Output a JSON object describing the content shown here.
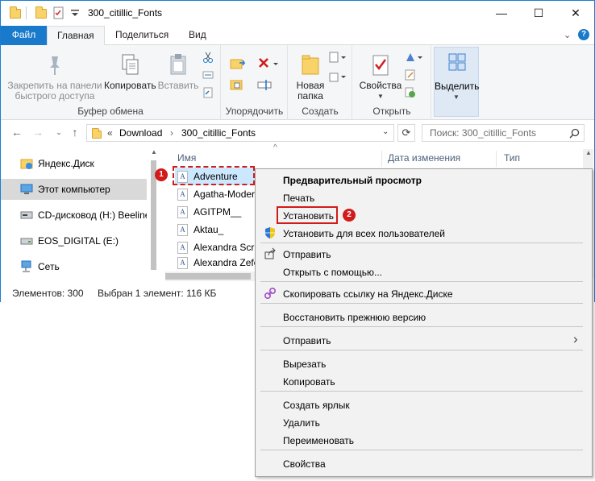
{
  "window": {
    "title": "300_citillic_Fonts",
    "controls": {
      "minimize": "—",
      "maximize": "☐",
      "close": "✕"
    }
  },
  "ribbon_tabs": [
    {
      "label": "Файл"
    },
    {
      "label": "Главная"
    },
    {
      "label": "Поделиться"
    },
    {
      "label": "Вид"
    }
  ],
  "ribbon": {
    "clipboard": {
      "pin_label_1": "Закрепить на панели",
      "pin_label_2": "быстрого доступа",
      "copy_label": "Копировать",
      "paste_label": "Вставить",
      "group_label": "Буфер обмена"
    },
    "organize": {
      "group_label": "Упорядочить"
    },
    "new": {
      "new_folder_label_1": "Новая",
      "new_folder_label_2": "папка",
      "group_label": "Создать"
    },
    "open": {
      "properties_label": "Свойства",
      "group_label": "Открыть"
    },
    "select": {
      "select_label": "Выделить"
    }
  },
  "address": {
    "prefix": "«",
    "crumbs": [
      "Download",
      "300_citillic_Fonts"
    ],
    "search_placeholder": "Поиск: 300_citillic_Fonts"
  },
  "nav_pane": {
    "items": [
      {
        "label": "Яндекс.Диск",
        "icon": "yandex-disk-icon"
      },
      {
        "label": "Этот компьютер",
        "icon": "computer-icon"
      },
      {
        "label": "CD-дисковод (H:) Beeline",
        "icon": "cd-drive-icon"
      },
      {
        "label": "EOS_DIGITAL (E:)",
        "icon": "drive-icon"
      },
      {
        "label": "Сеть",
        "icon": "network-icon"
      }
    ]
  },
  "file_list": {
    "columns": [
      "Имя",
      "Дата изменения",
      "Тип"
    ],
    "rows": [
      {
        "name": "Adventure",
        "icon_glyph": "A"
      },
      {
        "name": "Agatha-Modern",
        "icon_glyph": "A"
      },
      {
        "name": "AGITPM__",
        "icon_glyph": "A"
      },
      {
        "name": "Aktau_",
        "icon_glyph": "A"
      },
      {
        "name": "Alexandra Script",
        "icon_glyph": "A"
      },
      {
        "name": "Alexandra Zeferino",
        "icon_glyph": "A"
      }
    ]
  },
  "status": {
    "count": "Элементов: 300",
    "selected": "Выбран 1 элемент: 116 КБ"
  },
  "context_menu": {
    "items": [
      "Предварительный просмотр",
      "Печать",
      "Установить",
      "Установить для всех пользователей",
      "Отправить",
      "Открыть с помощью...",
      "Скопировать ссылку на Яндекс.Диске",
      "Восстановить прежнюю версию",
      "Отправить",
      "Вырезать",
      "Копировать",
      "Создать ярлык",
      "Удалить",
      "Переименовать",
      "Свойства"
    ],
    "submenu_arrow": "›"
  },
  "annotations": {
    "badge1": "1",
    "badge2": "2"
  },
  "colors": {
    "accent": "#1979ca",
    "annotation": "#d21a1a",
    "selection": "#cce8ff"
  }
}
